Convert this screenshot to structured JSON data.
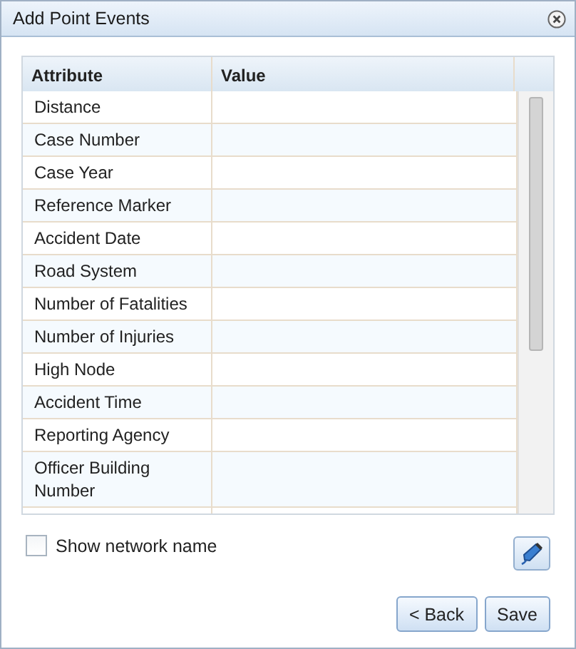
{
  "window": {
    "title": "Add Point Events"
  },
  "table": {
    "columns": [
      "Attribute",
      "Value"
    ],
    "rows": [
      {
        "attribute": "Distance",
        "value": ""
      },
      {
        "attribute": "Case Number",
        "value": ""
      },
      {
        "attribute": "Case Year",
        "value": ""
      },
      {
        "attribute": "Reference Marker",
        "value": ""
      },
      {
        "attribute": "Accident Date",
        "value": ""
      },
      {
        "attribute": "Road System",
        "value": ""
      },
      {
        "attribute": "Number of Fatalities",
        "value": ""
      },
      {
        "attribute": "Number of Injuries",
        "value": ""
      },
      {
        "attribute": "High Node",
        "value": ""
      },
      {
        "attribute": "Accident Time",
        "value": ""
      },
      {
        "attribute": "Reporting Agency",
        "value": ""
      },
      {
        "attribute": "Officer Building Number",
        "value": ""
      }
    ]
  },
  "show_network_name": {
    "label": "Show network name",
    "checked": false
  },
  "buttons": [
    "< Back",
    "Save"
  ]
}
